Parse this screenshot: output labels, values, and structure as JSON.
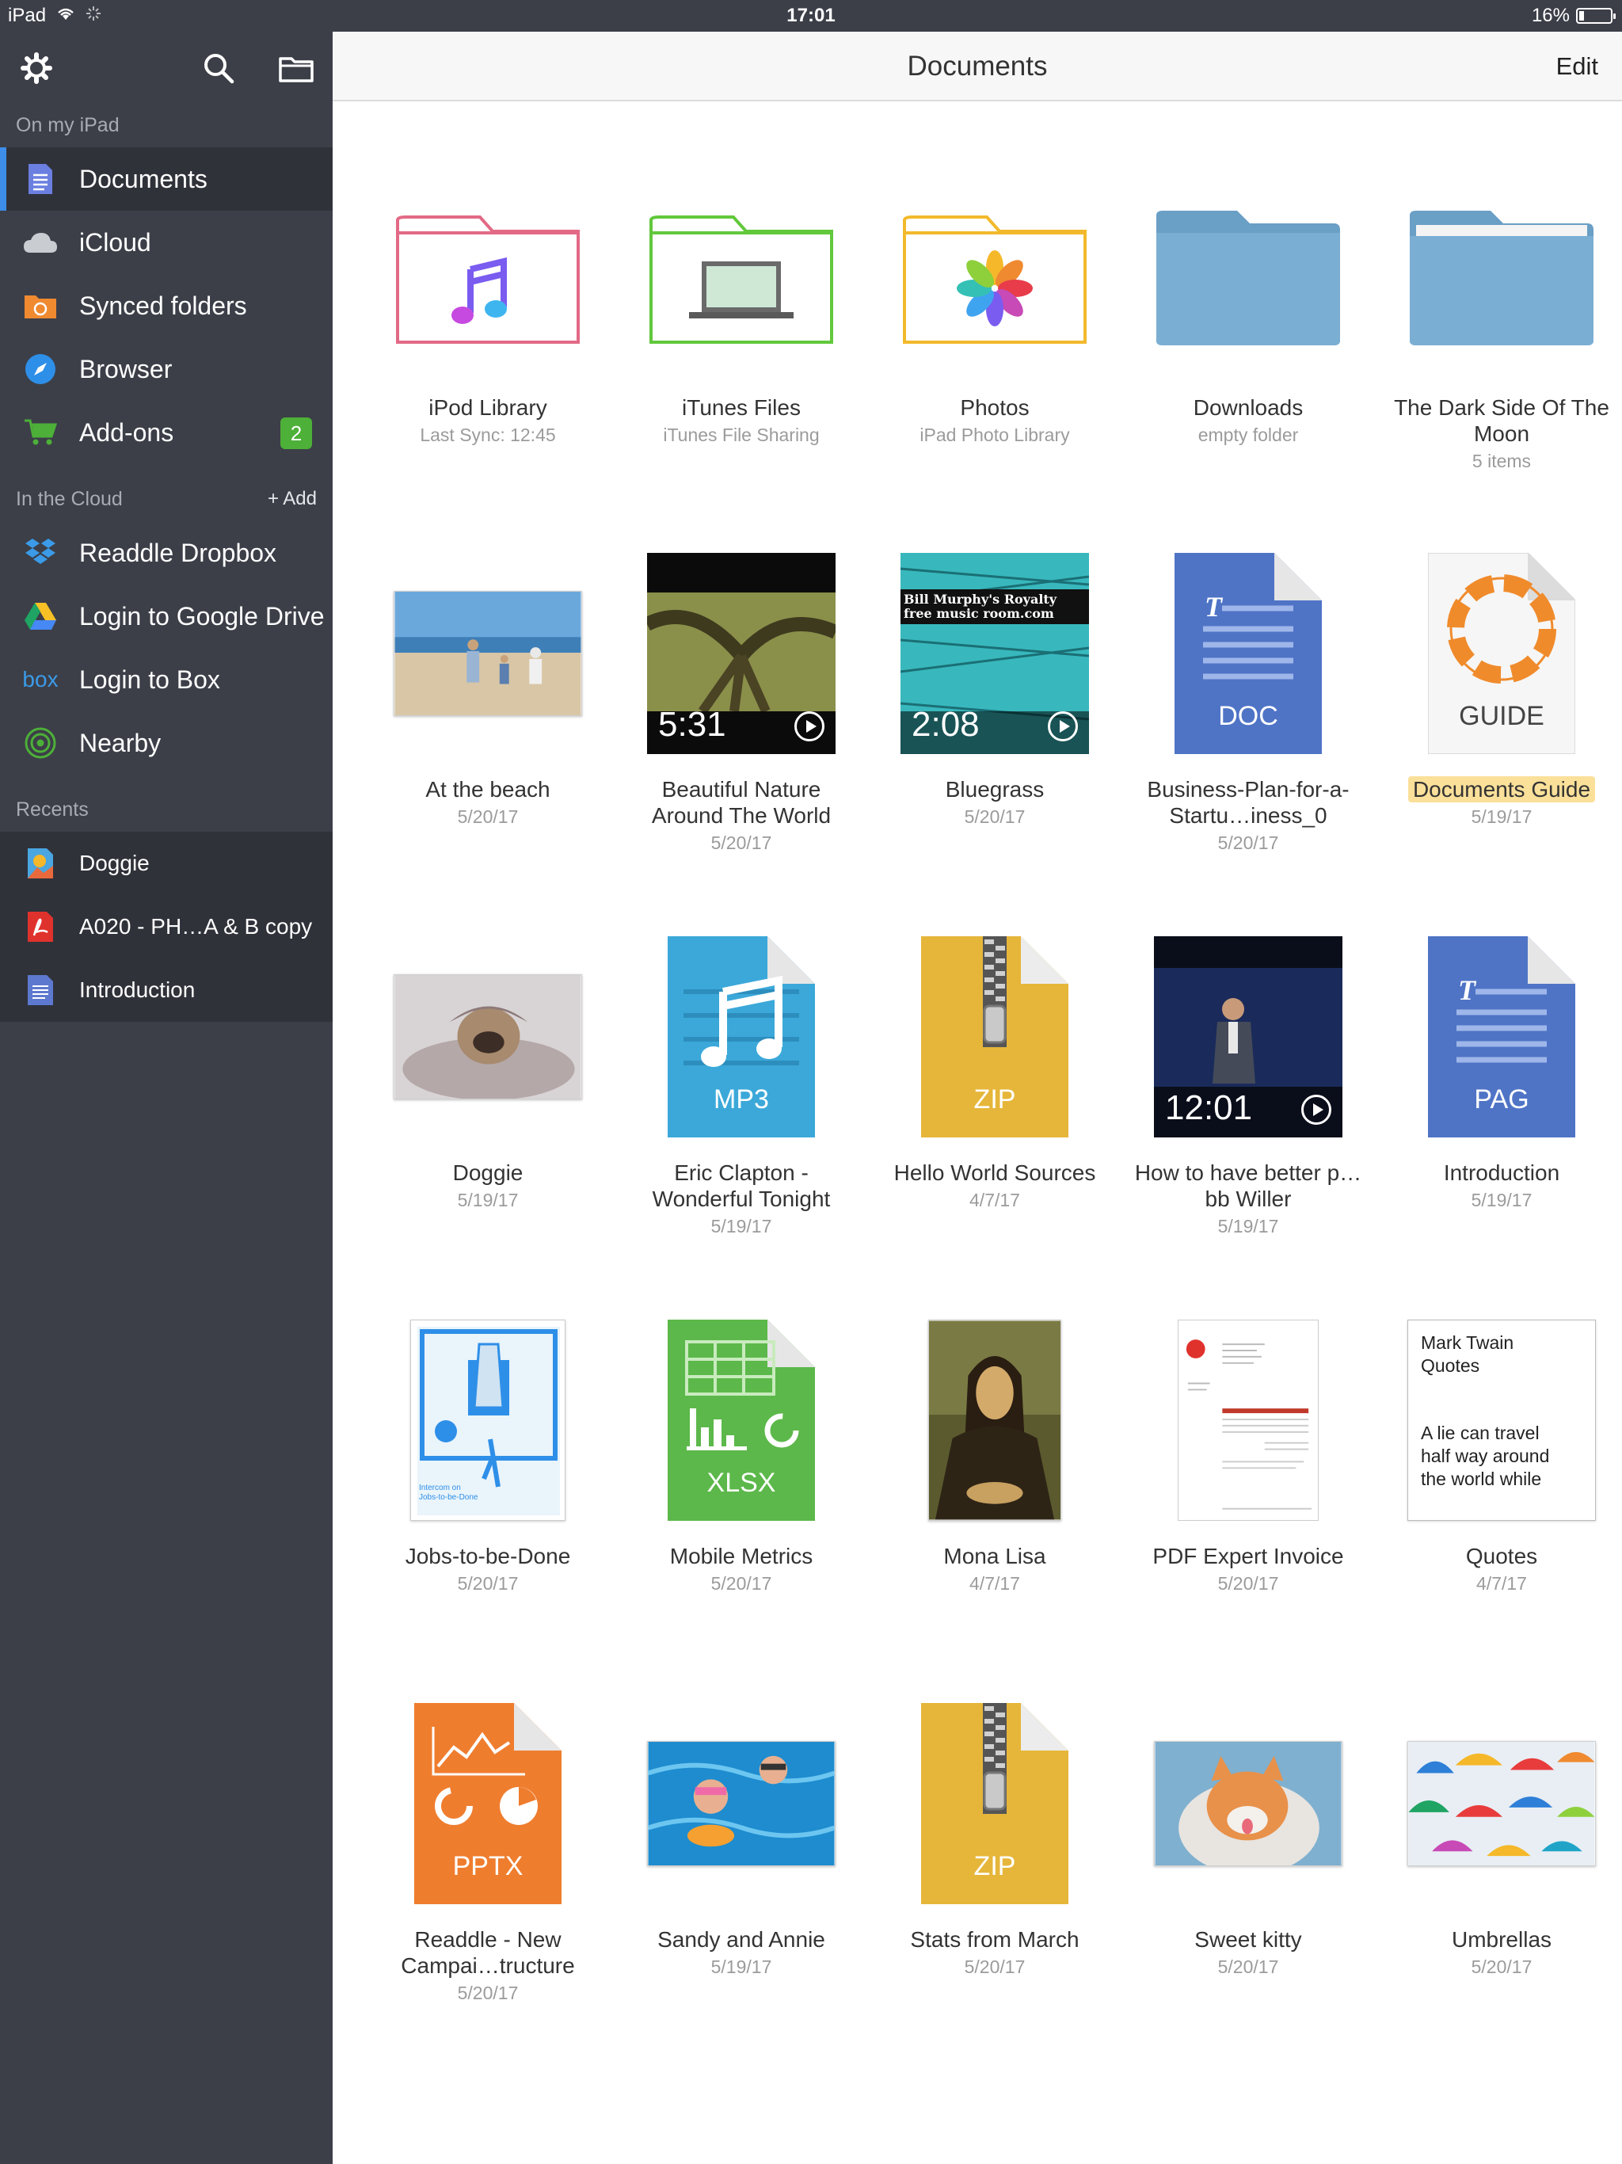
{
  "status_bar": {
    "device": "iPad",
    "time": "17:01",
    "battery": "16%",
    "battery_level": 0.16
  },
  "sidebar": {
    "on_my_ipad_label": "On my iPad",
    "in_the_cloud_label": "In the Cloud",
    "add_label": "+ Add",
    "recents_label": "Recents",
    "local_items": [
      {
        "label": "Documents",
        "icon": "document-icon"
      },
      {
        "label": "iCloud",
        "icon": "cloud-icon"
      },
      {
        "label": "Synced folders",
        "icon": "synced-folder-icon"
      },
      {
        "label": "Browser",
        "icon": "compass-icon"
      },
      {
        "label": "Add-ons",
        "icon": "cart-icon",
        "badge": "2"
      }
    ],
    "cloud_items": [
      {
        "label": "Readdle Dropbox",
        "icon": "dropbox-icon"
      },
      {
        "label": "Login to Google Drive",
        "icon": "google-drive-icon"
      },
      {
        "label": "Login to Box",
        "icon": "box-icon",
        "icon_text": "box"
      },
      {
        "label": "Nearby",
        "icon": "nearby-icon"
      }
    ],
    "recent_items": [
      {
        "label": "Doggie",
        "icon": "image-file-icon"
      },
      {
        "label": "A020 - PH…A & B copy",
        "icon": "pdf-icon"
      },
      {
        "label": "Introduction",
        "icon": "pages-file-icon"
      }
    ]
  },
  "header": {
    "title": "Documents",
    "edit_label": "Edit"
  },
  "colors": {
    "sidebar_bg": "#3c3f48",
    "accent_blue": "#3d8ee8",
    "badge_green": "#4db038",
    "highlight": "#fbe09a"
  },
  "items": [
    {
      "name": "iPod Library",
      "sub": "Last Sync: 12:45",
      "kind": "folder",
      "color": "#e26a86",
      "icon": "music-note-icon"
    },
    {
      "name": "iTunes Files",
      "sub": "iTunes File Sharing",
      "kind": "folder",
      "color": "#62c83c",
      "icon": "laptop-icon"
    },
    {
      "name": "Photos",
      "sub": "iPad Photo Library",
      "kind": "folder",
      "color": "#f2b92c",
      "icon": "photos-flower-icon"
    },
    {
      "name": "Downloads",
      "sub": "empty folder",
      "kind": "folder-filled",
      "color": "#7baed3"
    },
    {
      "name": "The Dark Side Of The Moon",
      "sub": "5 items",
      "kind": "folder-filled",
      "color": "#7baed3"
    },
    {
      "name": "At the beach",
      "sub": "5/20/17",
      "kind": "photo",
      "icon": "beach-photo"
    },
    {
      "name": "Beautiful Nature Around The World",
      "sub": "5/20/17",
      "kind": "video",
      "duration": "5:31",
      "icon": "tree-video"
    },
    {
      "name": "Bluegrass",
      "sub": "5/20/17",
      "kind": "video",
      "duration": "2:08",
      "overlay": "Bill Murphy's Royalty free music room.com",
      "icon": "bluegrass-video"
    },
    {
      "name": "Business-Plan-for-a-Startu…iness_0",
      "sub": "5/20/17",
      "kind": "doc",
      "label": "DOC",
      "color": "#4f74c6"
    },
    {
      "name": "Documents Guide",
      "sub": "5/19/17",
      "kind": "guide",
      "label": "GUIDE",
      "color": "#f08b2c",
      "highlight": true
    },
    {
      "name": "Doggie",
      "sub": "5/19/17",
      "kind": "photo",
      "icon": "dog-photo"
    },
    {
      "name": "Eric Clapton - Wonderful Tonight",
      "sub": "5/19/17",
      "kind": "doc",
      "label": "MP3",
      "color": "#3ba8d9"
    },
    {
      "name": "Hello World Sources",
      "sub": "4/7/17",
      "kind": "zip",
      "label": "ZIP",
      "color": "#e6b63a"
    },
    {
      "name": "How to have better p…bb Willer",
      "sub": "5/19/17",
      "kind": "video",
      "duration": "12:01",
      "icon": "talk-video"
    },
    {
      "name": "Introduction",
      "sub": "5/19/17",
      "kind": "doc",
      "label": "PAG",
      "color": "#4f74c6"
    },
    {
      "name": "Jobs-to-be-Done",
      "sub": "5/20/17",
      "kind": "jobs",
      "small_text": "Intercom on Jobs-to-be-Done"
    },
    {
      "name": "Mobile Metrics",
      "sub": "5/20/17",
      "kind": "doc",
      "label": "XLSX",
      "color": "#5cb84a"
    },
    {
      "name": "Mona Lisa",
      "sub": "4/7/17",
      "kind": "painting",
      "icon": "mona-lisa-painting"
    },
    {
      "name": "PDF Expert Invoice",
      "sub": "5/20/17",
      "kind": "invoice"
    },
    {
      "name": "Quotes",
      "sub": "4/7/17",
      "kind": "note",
      "note_title": "Mark Twain Quotes",
      "note_body": "A lie can travel half way around the world while"
    },
    {
      "name": "Readdle - New Campai…tructure",
      "sub": "5/20/17",
      "kind": "doc",
      "label": "PPTX",
      "color": "#ef7d2e"
    },
    {
      "name": "Sandy and Annie",
      "sub": "5/19/17",
      "kind": "photo",
      "icon": "pool-photo"
    },
    {
      "name": "Stats from March",
      "sub": "5/20/17",
      "kind": "zip",
      "label": "ZIP",
      "color": "#e6b63a"
    },
    {
      "name": "Sweet kitty",
      "sub": "5/20/17",
      "kind": "photo",
      "icon": "kitten-photo"
    },
    {
      "name": "Umbrellas",
      "sub": "5/20/17",
      "kind": "photo",
      "icon": "umbrellas-photo"
    }
  ]
}
